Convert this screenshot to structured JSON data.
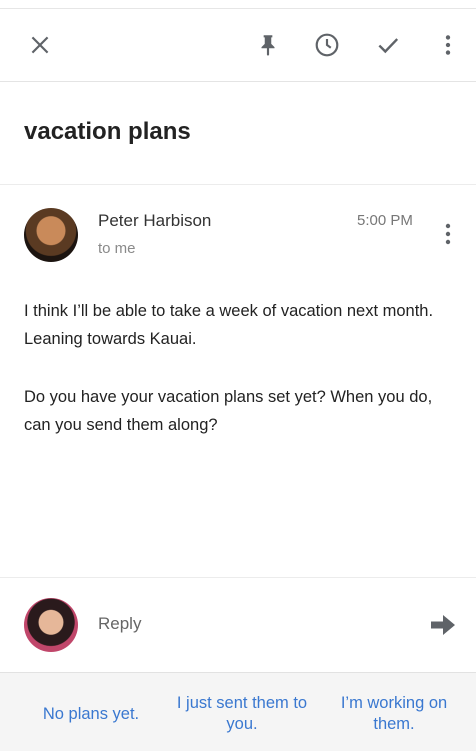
{
  "toolbar": {
    "close_icon": "close-icon",
    "pin_icon": "pin-icon",
    "snooze_icon": "clock-icon",
    "done_icon": "check-icon",
    "more_icon": "more-vertical-icon"
  },
  "email": {
    "subject": "vacation plans",
    "sender": "Peter Harbison",
    "recipient": "to me",
    "time": "5:00 PM",
    "body": [
      "I think I’ll be able to take a week of vacation next month. Leaning towards Kauai.",
      "Do you have your vacation plans set yet? When you do, can you send them along?"
    ]
  },
  "reply": {
    "placeholder": "Reply",
    "send_icon": "arrow-right-icon"
  },
  "smart_replies": [
    "No plans yet.",
    "I just sent them to you.",
    "I’m working on them."
  ],
  "colors": {
    "link_blue": "#3a78d0",
    "icon_gray": "#5f6368"
  }
}
